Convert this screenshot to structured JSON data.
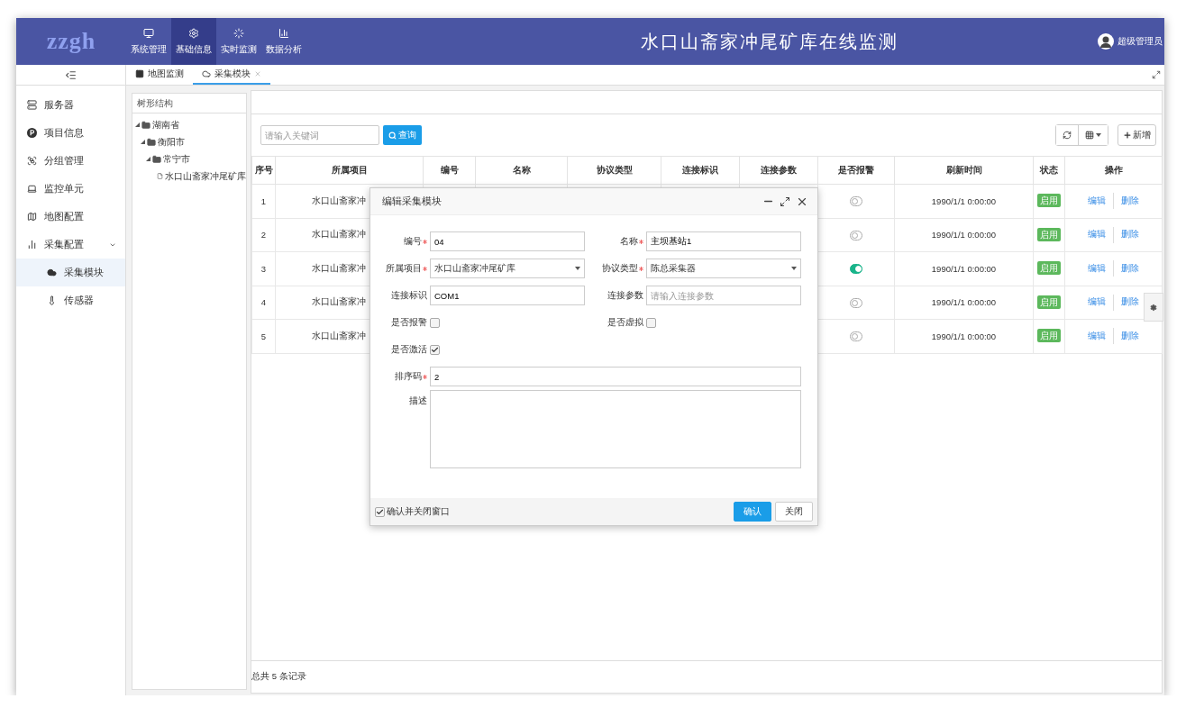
{
  "header": {
    "logo": "zzgh",
    "title": "水口山斋家冲尾矿库在线监测",
    "user": "超级管理员",
    "nav": [
      {
        "label": "系统管理",
        "selected": false
      },
      {
        "label": "基础信息",
        "selected": true
      },
      {
        "label": "实时监测",
        "selected": false
      },
      {
        "label": "数据分析",
        "selected": false
      }
    ]
  },
  "tabs": [
    {
      "label": "地图监测",
      "selected": false,
      "closable": false
    },
    {
      "label": "采集模块",
      "selected": true,
      "closable": true
    }
  ],
  "sidebar": {
    "items": [
      {
        "label": "服务器",
        "selected": false
      },
      {
        "label": "项目信息",
        "selected": false
      },
      {
        "label": "分组管理",
        "selected": false
      },
      {
        "label": "监控单元",
        "selected": false
      },
      {
        "label": "地图配置",
        "selected": false
      },
      {
        "label": "采集配置",
        "selected": false,
        "expanded": true,
        "children": [
          {
            "label": "采集模块",
            "selected": true
          },
          {
            "label": "传感器",
            "selected": false
          }
        ]
      }
    ]
  },
  "tree": {
    "title": "树形结构",
    "nodes": [
      {
        "label": "湖南省",
        "expanded": true,
        "children": [
          {
            "label": "衡阳市",
            "expanded": true,
            "children": [
              {
                "label": "常宁市",
                "expanded": true,
                "children": [
                  {
                    "label": "水口山斋家冲尾矿库"
                  }
                ]
              }
            ]
          }
        ]
      }
    ]
  },
  "toolbar": {
    "search_placeholder": "请输入关键词",
    "search_button": "查询",
    "add_button": "新增"
  },
  "table": {
    "columns": [
      "序号",
      "所属项目",
      "编号",
      "名称",
      "协议类型",
      "连接标识",
      "连接参数",
      "是否报警",
      "刷新时间",
      "状态",
      "操作"
    ],
    "rows": [
      {
        "index": "1",
        "project": "水口山斋家冲",
        "alarm": false,
        "time": "1990/1/1 0:00:00",
        "status": "启用",
        "actions": [
          "编辑",
          "删除"
        ]
      },
      {
        "index": "2",
        "project": "水口山斋家冲",
        "alarm": false,
        "time": "1990/1/1 0:00:00",
        "status": "启用",
        "actions": [
          "编辑",
          "删除"
        ]
      },
      {
        "index": "3",
        "project": "水口山斋家冲",
        "alarm": true,
        "time": "1990/1/1 0:00:00",
        "status": "启用",
        "actions": [
          "编辑",
          "删除"
        ]
      },
      {
        "index": "4",
        "project": "水口山斋家冲",
        "alarm": false,
        "time": "1990/1/1 0:00:00",
        "status": "启用",
        "actions": [
          "编辑",
          "删除"
        ]
      },
      {
        "index": "5",
        "project": "水口山斋家冲",
        "alarm": false,
        "time": "1990/1/1 0:00:00",
        "status": "启用",
        "actions": [
          "编辑",
          "删除"
        ]
      }
    ],
    "footer": "总共 5 条记录"
  },
  "dialog": {
    "title": "编辑采集模块",
    "fields": [
      {
        "kind": "text",
        "label": "编号",
        "required": true,
        "value": "04"
      },
      {
        "kind": "text",
        "label": "名称",
        "required": true,
        "value": "主坝基站1"
      },
      {
        "kind": "select",
        "label": "所属项目",
        "required": true,
        "value": "水口山斋家冲尾矿库"
      },
      {
        "kind": "select",
        "label": "协议类型",
        "required": true,
        "value": "陈总采集器"
      },
      {
        "kind": "text",
        "label": "连接标识",
        "required": false,
        "value": "COM1"
      },
      {
        "kind": "text",
        "label": "连接参数",
        "required": false,
        "placeholder": "请输入连接参数"
      },
      {
        "kind": "checkbox",
        "label": "是否报警",
        "checked": false
      },
      {
        "kind": "checkbox",
        "label": "是否虚拟",
        "checked": false
      },
      {
        "kind": "checkbox",
        "label": "是否激活",
        "checked": true
      },
      {
        "kind": "wide",
        "label": "排序码",
        "required": true,
        "value": "2"
      },
      {
        "kind": "textarea",
        "label": "描述",
        "required": false
      }
    ],
    "close_after_confirm": {
      "label": "确认并关闭窗口",
      "checked": true
    },
    "buttons": [
      {
        "label": "确认",
        "primary": true
      },
      {
        "label": "关闭",
        "primary": false
      }
    ]
  }
}
